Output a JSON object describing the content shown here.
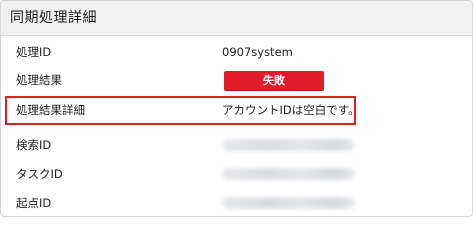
{
  "panel": {
    "title": "同期処理詳細"
  },
  "rows": [
    {
      "label": "処理ID",
      "value": "0907system"
    },
    {
      "label": "処理結果",
      "badge": "失敗"
    },
    {
      "label": "処理結果詳細",
      "value": "アカウントIDは空白です。"
    },
    {
      "label": "検索ID",
      "value_redacted": true
    },
    {
      "label": "タスクID",
      "value_redacted": true
    },
    {
      "label": "起点ID",
      "value_redacted": true
    }
  ],
  "colors": {
    "badge_failure": "#e21b2b",
    "highlight_border": "#e02020",
    "header_bg": "#f1f1f1"
  }
}
